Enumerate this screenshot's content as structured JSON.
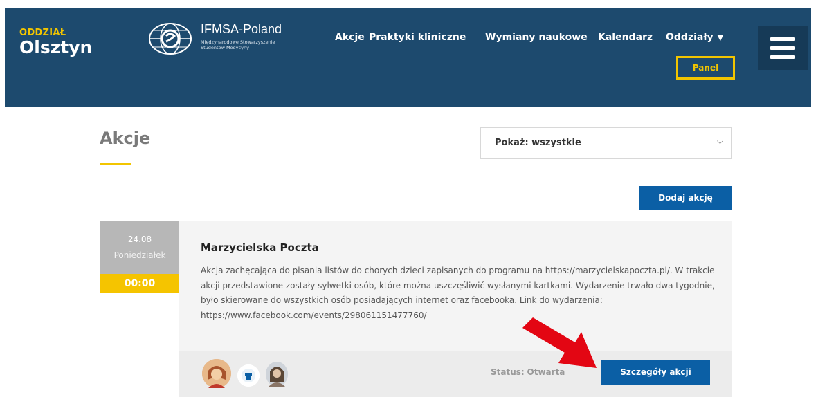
{
  "header": {
    "branch_label": "ODDZIAŁ",
    "branch_name": "Olsztyn",
    "logo_name": "IFMSA-Poland",
    "logo_sub": "Międzynarodowe Stowarzyszenie Studentów Medycyny",
    "nav": {
      "akcje": "Akcje",
      "praktyki": "Praktyki kliniczne",
      "wymiany": "Wymiany naukowe",
      "kalendarz": "Kalendarz",
      "oddzialy": "Oddziały"
    },
    "panel": "Panel"
  },
  "main": {
    "title": "Akcje",
    "filter_value": "Pokaż: wszystkie",
    "add_button": "Dodaj akcję"
  },
  "event": {
    "date": "24.08",
    "weekday": "Poniedziałek",
    "time": "00:00",
    "title": "Marzycielska Poczta",
    "description": "Akcja zachęcająca do pisania listów do chorych dzieci zapisanych do programu na https://marzycielskapoczta.pl/. W trakcie akcji przedstawione zostały sylwetki osób, które można uszczęśliwić wysłanymi kartkami. Wydarzenie trwało dwa tygodnie, było skierowane do wszystkich osób posiadających internet oraz facebooka. Link do wydarzenia: https://www.facebook.com/events/298061151477760/",
    "status_label": "Status:",
    "status_value": "Otwarta",
    "details_button": "Szczegóły akcji"
  },
  "colors": {
    "header_bg": "#1d4a6e",
    "accent_yellow": "#f2c500",
    "button_blue": "#0b5fa5",
    "arrow_red": "#e30613"
  }
}
